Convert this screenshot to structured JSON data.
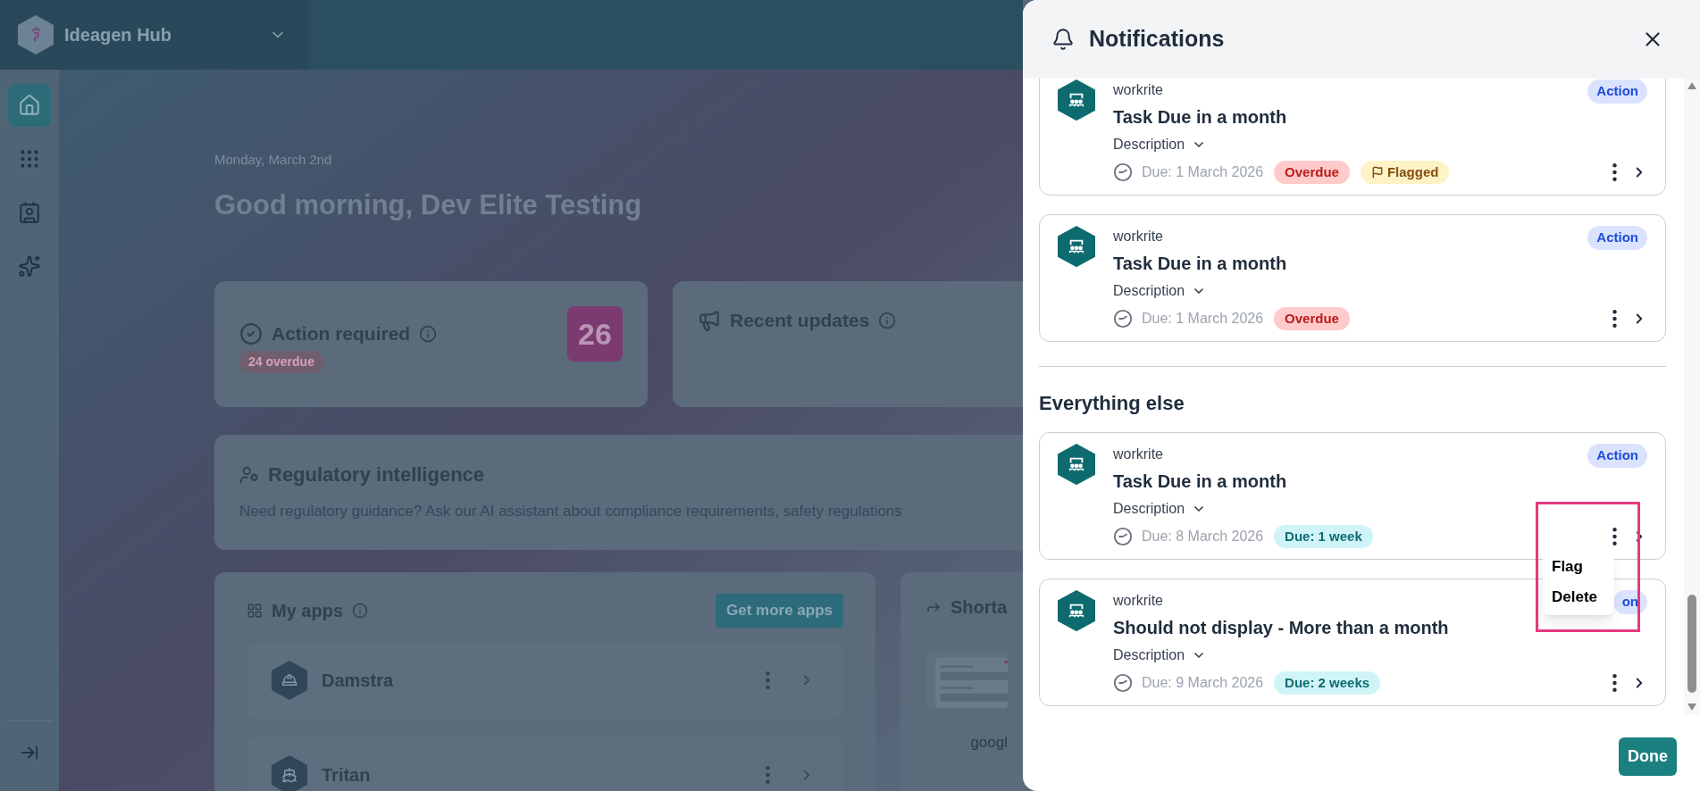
{
  "app": {
    "name": "Ideagen Hub"
  },
  "sidebar": {
    "items": [
      {
        "kind": "home",
        "selected": true
      },
      {
        "kind": "apps",
        "selected": false
      },
      {
        "kind": "user",
        "selected": false
      },
      {
        "kind": "ai",
        "selected": false
      }
    ]
  },
  "greeting": {
    "date": "Monday, March 2nd",
    "title": "Good morning, Dev Elite Testing"
  },
  "summary_cards": [
    {
      "kind": "action",
      "title": "Action required",
      "count": "26",
      "badge": "24 overdue"
    },
    {
      "kind": "updates",
      "title": "Recent updates"
    }
  ],
  "regulatory": {
    "title": "Regulatory intelligence",
    "text": "Need regulatory guidance? Ask our AI assistant about compliance requirements, safety regulations"
  },
  "my_apps": {
    "title": "My apps",
    "button": "Get more apps",
    "apps": [
      {
        "name": "Damstra",
        "kind": "worker"
      },
      {
        "name": "Tritan",
        "kind": "ship"
      }
    ]
  },
  "shortcuts": {
    "title": "Shorta",
    "items": [
      {
        "label": "googl",
        "kind": "picture"
      }
    ]
  },
  "notifications": {
    "title": "Notifications",
    "done": "Done",
    "sections": [
      {
        "items": [
          {
            "source": "workrite",
            "title": "Task Due in a month",
            "description": "Description",
            "due": "Due: 1 March 2026",
            "badge": "Action",
            "tags": [
              {
                "label": "Overdue",
                "kind": "overdue"
              },
              {
                "label": "Flagged",
                "kind": "flagged"
              }
            ]
          },
          {
            "source": "workrite",
            "title": "Task Due in a month",
            "description": "Description",
            "due": "Due: 1 March 2026",
            "badge": "Action",
            "tags": [
              {
                "label": "Overdue",
                "kind": "overdue"
              }
            ]
          }
        ]
      },
      {
        "title": "Everything else",
        "items": [
          {
            "source": "workrite",
            "title": "Task Due in a month",
            "description": "Description",
            "due": "Due: 8 March 2026",
            "badge": "Action",
            "tags": [
              {
                "label": "Due: 1 week",
                "kind": "due"
              }
            ],
            "menu": [
              "Flag",
              "Delete"
            ]
          },
          {
            "source": "workrite",
            "title": "Should not display - More than a month",
            "description": "Description",
            "due": "Due: 9 March 2026",
            "badge": "on",
            "tags": [
              {
                "label": "Due: 2 weeks",
                "kind": "due"
              }
            ]
          }
        ]
      }
    ]
  }
}
